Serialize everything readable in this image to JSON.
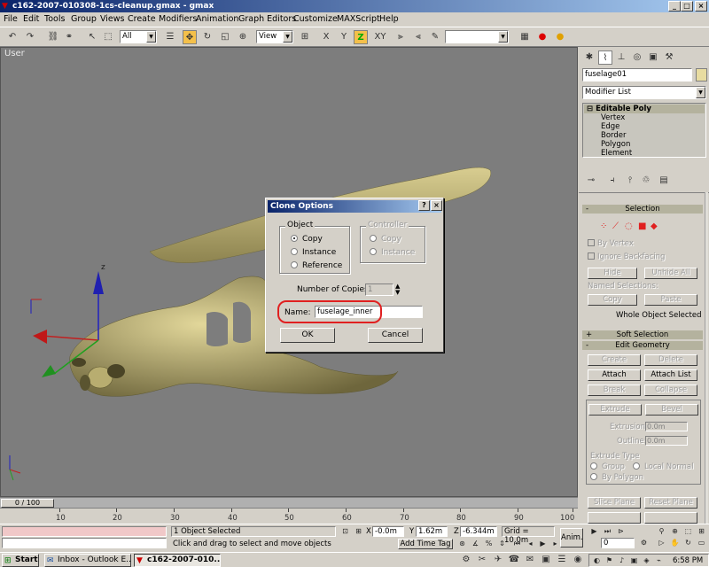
{
  "window": {
    "title": "c162-2007-010308-1cs-cleanup.gmax - gmax",
    "controls": [
      "_",
      "□",
      "×"
    ]
  },
  "menu": [
    "File",
    "Edit",
    "Tools",
    "Group",
    "Views",
    "Create",
    "Modifiers",
    "Animation",
    "Graph Editors",
    "Customize",
    "MAXScript",
    "Help"
  ],
  "toolbar": {
    "selection_filter": "All",
    "reference_coord": "View",
    "named_selection": "",
    "axis_constraints": [
      "X",
      "Y",
      "Z",
      "XY"
    ]
  },
  "viewport": {
    "label": "User",
    "axis_label": "z"
  },
  "dialog": {
    "title": "Clone Options",
    "help": "?",
    "close": "×",
    "object_group": "Object",
    "object_options": [
      "Copy",
      "Instance",
      "Reference"
    ],
    "object_selected": "Copy",
    "controller_group": "Controller",
    "controller_options": [
      "Copy",
      "Instance"
    ],
    "copies_label": "Number of Copies:",
    "copies_value": "1",
    "name_label": "Name:",
    "name_value": "fuselage_inner",
    "ok": "OK",
    "cancel": "Cancel"
  },
  "command_panel": {
    "object_name": "fuselage01",
    "modifier_list": "Modifier List",
    "stack": {
      "root": "Editable Poly",
      "root_sign": "⊟",
      "subobjects": [
        "Vertex",
        "Edge",
        "Border",
        "Polygon",
        "Element"
      ]
    },
    "selection": {
      "header": "Selection",
      "sign": "-",
      "by_vertex": "By Vertex",
      "ignore_backfacing": "Ignore Backfacing",
      "hide": "Hide",
      "unhide_all": "Unhide All",
      "named_selections": "Named Selections:",
      "copy": "Copy",
      "paste": "Paste",
      "status": "Whole Object Selected"
    },
    "soft_selection": {
      "header": "Soft Selection",
      "sign": "+"
    },
    "edit_geometry": {
      "header": "Edit Geometry",
      "sign": "-",
      "create": "Create",
      "delete": "Delete",
      "attach": "Attach",
      "attach_list": "Attach List",
      "break": "Break",
      "collapse": "Collapse",
      "extrude": "Extrude",
      "bevel": "Bevel",
      "extrusion_label": "Extrusion:",
      "extrusion_value": "0.0m",
      "outline_label": "Outline:",
      "outline_value": "0.0m",
      "extrude_type": "Extrude Type",
      "group": "Group",
      "local_normal": "Local Normal",
      "by_polygon": "By Polygon",
      "slice_plane": "Slice Plane",
      "reset_plane": "Reset Plane"
    }
  },
  "timeline": {
    "frame_display": "0 / 100",
    "ticks": [
      "10",
      "20",
      "30",
      "40",
      "50",
      "60",
      "70",
      "80",
      "90",
      "100"
    ]
  },
  "status": {
    "selection": "1 Object Selected",
    "prompt": "Click and drag to select and move objects",
    "x_label": "X",
    "x_value": "-0.0m",
    "y_label": "Y",
    "y_value": "1.62m",
    "z_label": "Z",
    "z_value": "-6.344m",
    "grid": "Grid = 10.0m",
    "add_time_tag": "Add Time Tag",
    "anim": "Anim.",
    "frame_value": "0"
  },
  "taskbar": {
    "start": "Start",
    "tasks": [
      "Inbox - Outlook E...",
      "c162-2007-010..."
    ],
    "clock": "6:58 PM"
  },
  "colors": {
    "title_active": "#0a246a",
    "highlight_red": "#e02020",
    "model_fill": "#c8bd80",
    "viewport_bg": "#7d7d7d",
    "rollout_header": "#b4b29e"
  }
}
